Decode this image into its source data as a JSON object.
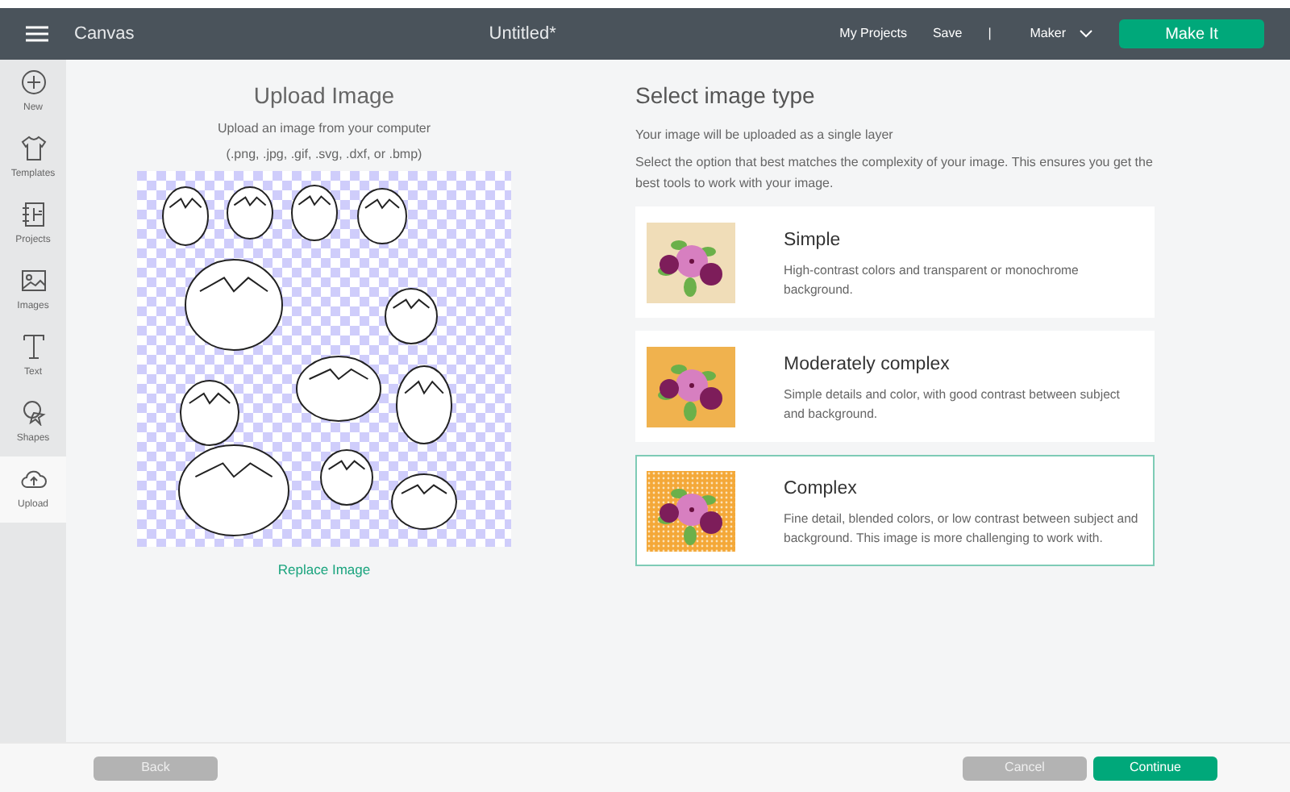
{
  "header": {
    "app_title": "Canvas",
    "document_title": "Untitled*",
    "links": [
      "My Projects",
      "Save"
    ],
    "separator": "|",
    "machine": "Maker",
    "primary_button": "Make It"
  },
  "sidebar": {
    "items": [
      {
        "label": "New",
        "kind": "plus",
        "selected": false
      },
      {
        "label": "Templates",
        "kind": "shirt",
        "selected": false
      },
      {
        "label": "Projects",
        "kind": "notebook",
        "selected": false
      },
      {
        "label": "Images",
        "kind": "picture",
        "selected": false
      },
      {
        "label": "Text",
        "kind": "letter",
        "selected": false
      },
      {
        "label": "Shapes",
        "kind": "shapes",
        "selected": false
      },
      {
        "label": "Upload",
        "kind": "cloud",
        "selected": true
      }
    ]
  },
  "upload": {
    "title": "Upload Image",
    "subtitle": "Upload an image from your computer",
    "formats": "(.png, .jpg, .gif, .svg, .dxf, or .bmp)",
    "replace_link": "Replace Image"
  },
  "image_type": {
    "title": "Select image type",
    "note": "Your image will be uploaded as a single layer",
    "instructions": "Select the option that best matches the complexity of your image. This ensures you get the best tools to work with your image.",
    "options": [
      {
        "kind": "plain",
        "name": "Simple",
        "description": "High-contrast colors and transparent or monochrome background.",
        "selected": false
      },
      {
        "kind": "solid",
        "name": "Moderately complex",
        "description": "Simple details and color, with good contrast between subject and background.",
        "selected": false
      },
      {
        "kind": "pattern",
        "name": "Complex",
        "description": "Fine detail, blended colors, or low contrast between subject and background. This image is more challenging to work with.",
        "selected": true
      }
    ]
  },
  "footer": {
    "back": "Back",
    "cancel": "Cancel",
    "continue": "Continue"
  }
}
